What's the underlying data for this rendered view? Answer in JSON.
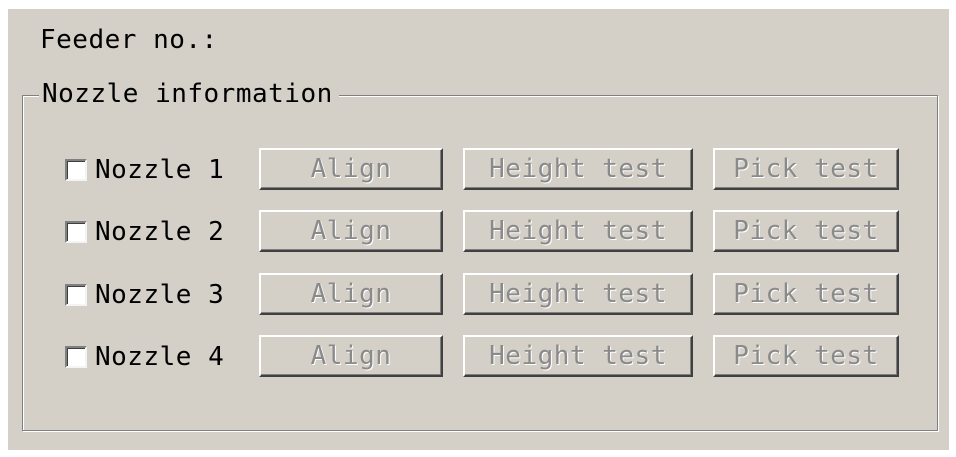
{
  "feeder_label": "Feeder no.:",
  "group_title": "Nozzle information",
  "nozzles": [
    {
      "label": "Nozzle 1",
      "checked": false,
      "align_label": "Align",
      "height_label": "Height test",
      "pick_label": "Pick test"
    },
    {
      "label": "Nozzle 2",
      "checked": false,
      "align_label": "Align",
      "height_label": "Height test",
      "pick_label": "Pick test"
    },
    {
      "label": "Nozzle 3",
      "checked": false,
      "align_label": "Align",
      "height_label": "Height test",
      "pick_label": "Pick test"
    },
    {
      "label": "Nozzle 4",
      "checked": false,
      "align_label": "Align",
      "height_label": "Height test",
      "pick_label": "Pick test"
    }
  ],
  "colors": {
    "window_background": "#d4d0c8",
    "disabled_text": "#8a8a8a",
    "text": "#000000"
  }
}
